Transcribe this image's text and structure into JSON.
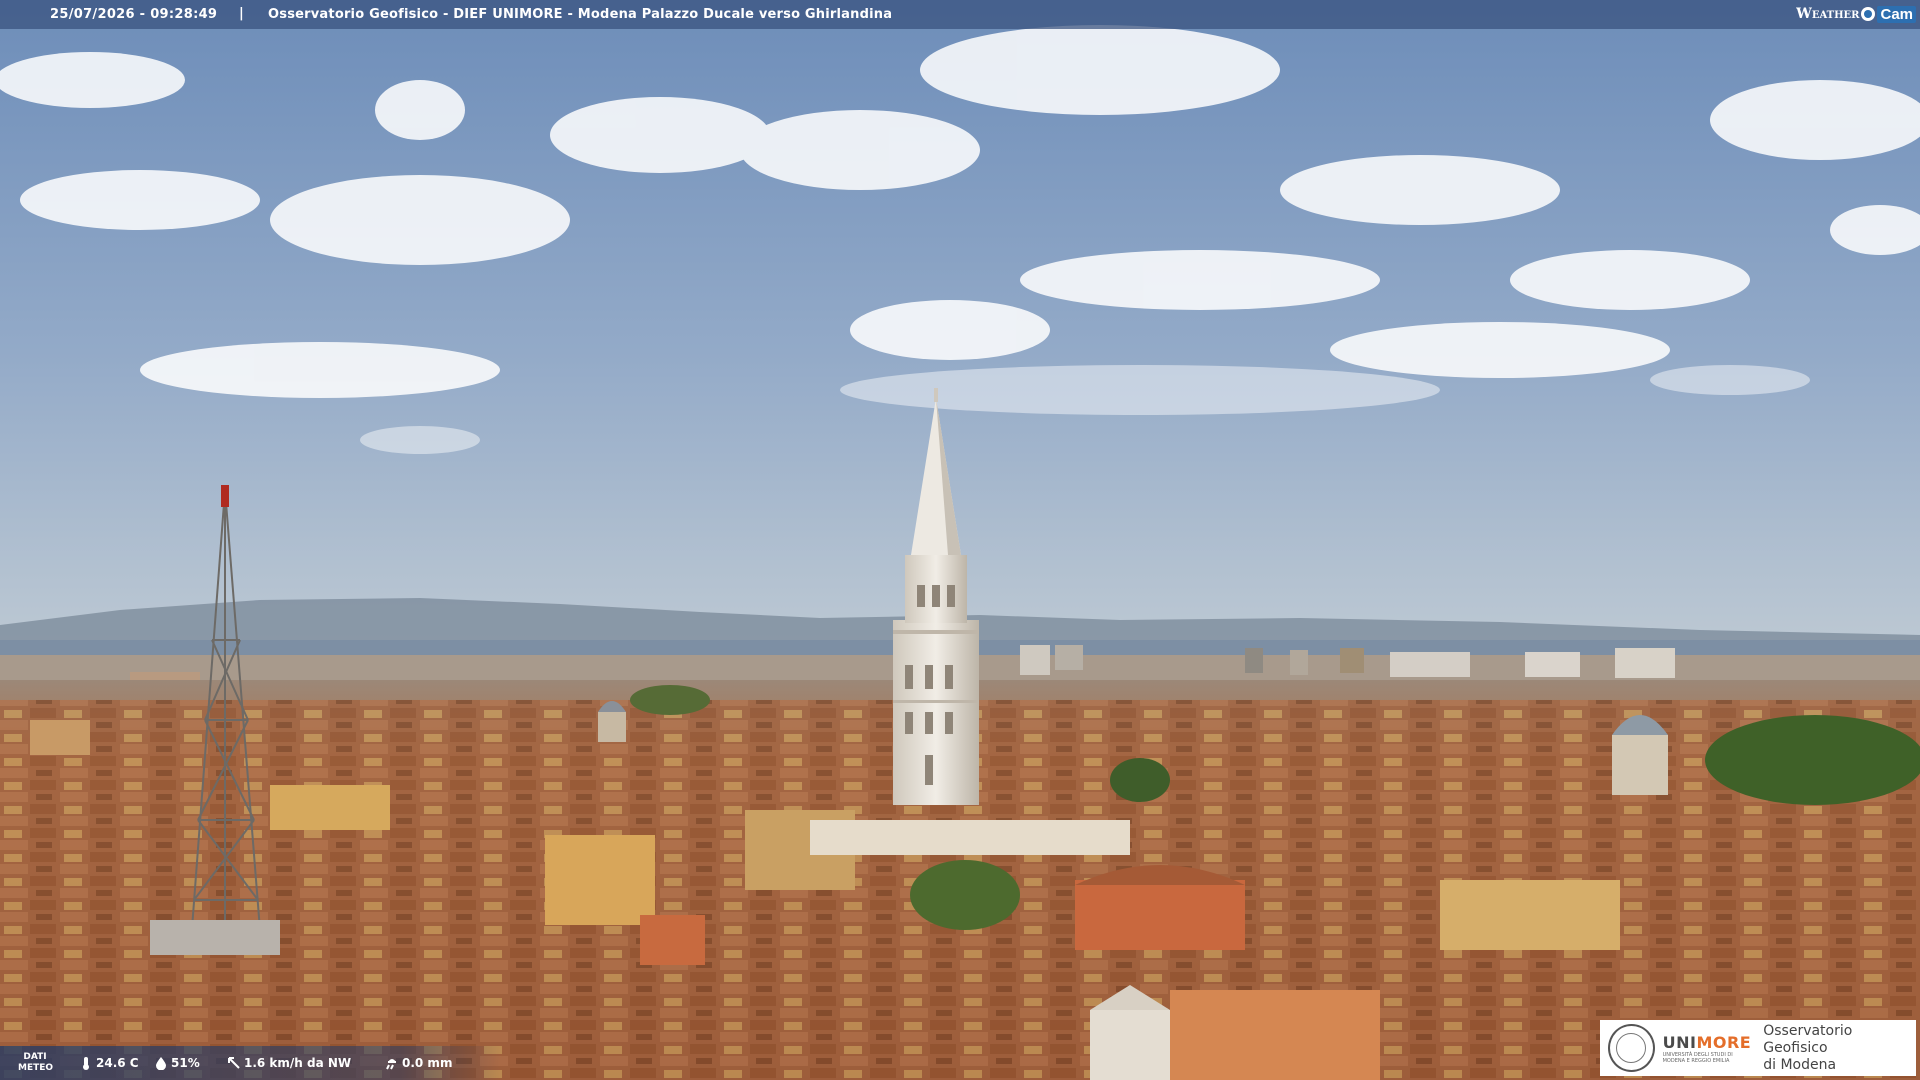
{
  "header": {
    "timestamp": "25/07/2026 - 09:28:49",
    "separator": "|",
    "title": "Osservatorio Geofisico - DIEF UNIMORE - Modena Palazzo Ducale verso Ghirlandina"
  },
  "brand": {
    "weather": "Weather",
    "cam": "Cam"
  },
  "weather_bar": {
    "label_line1": "DATI",
    "label_line2": "METEO",
    "temperature": "24.6 C",
    "humidity": "51%",
    "wind": "1.6 km/h da NW",
    "rain": "0.0 mm"
  },
  "logo": {
    "uni_part1": "UNI",
    "uni_part2": "MORE",
    "uni_sub_line1": "UNIVERSITÀ DEGLI STUDI DI",
    "uni_sub_line2": "MODENA E REGGIO EMILIA",
    "observatory_line1": "Osservatorio Geofisico",
    "observatory_line2": "di Modena"
  },
  "colors": {
    "sky_top": "#6f8fba",
    "sky_horizon": "#b8c6d4",
    "roof": "#a8643e",
    "tower": "#e8e3da",
    "bar": "#37507d",
    "accent": "#e46e2a"
  }
}
